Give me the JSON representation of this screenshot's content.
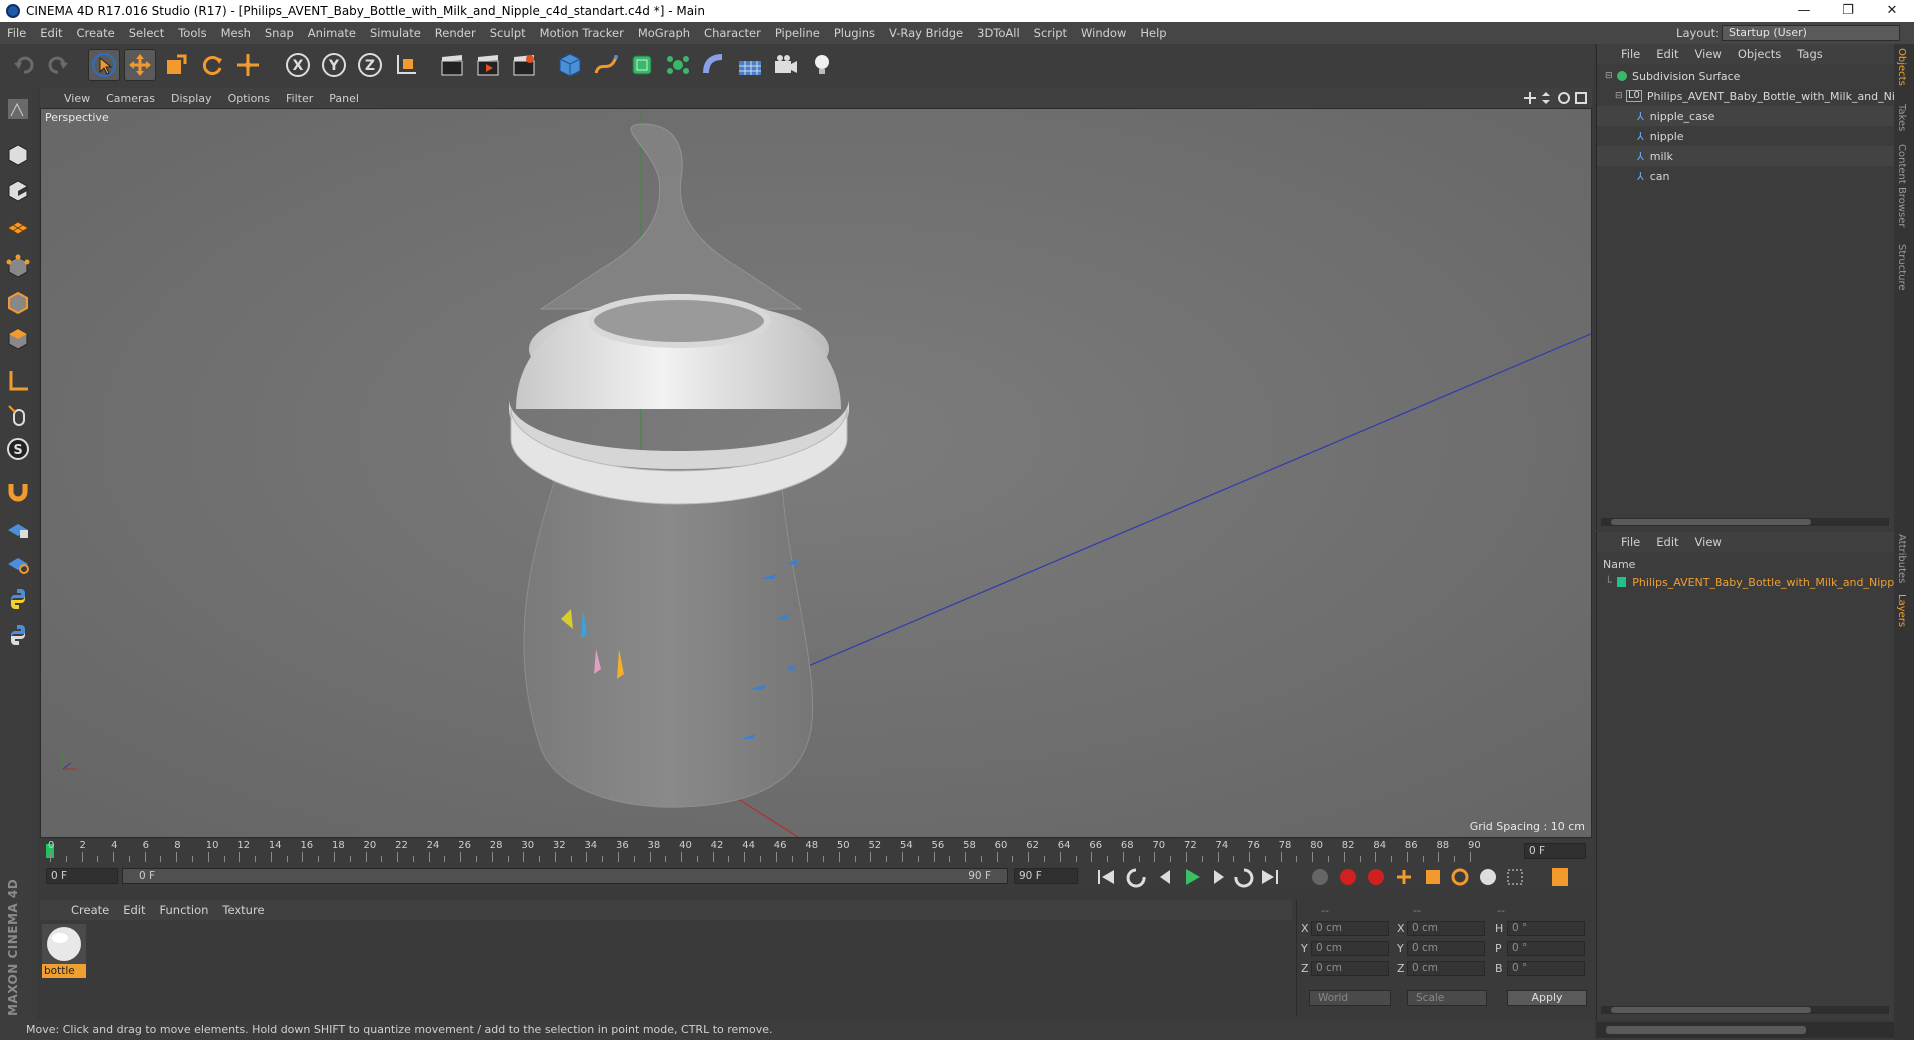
{
  "window": {
    "title": "CINEMA 4D R17.016 Studio (R17) - [Philips_AVENT_Baby_Bottle_with_Milk_and_Nipple_c4d_standart.c4d *] - Main",
    "controls": [
      "—",
      "❐",
      "✕"
    ]
  },
  "menubar": {
    "items": [
      "File",
      "Edit",
      "Create",
      "Select",
      "Tools",
      "Mesh",
      "Snap",
      "Animate",
      "Simulate",
      "Render",
      "Sculpt",
      "Motion Tracker",
      "MoGraph",
      "Character",
      "Pipeline",
      "Plugins",
      "V-Ray Bridge",
      "3DToAll",
      "Script",
      "Window",
      "Help"
    ],
    "layout_label": "Layout:",
    "layout_value": "Startup (User)"
  },
  "viewport": {
    "menu": [
      "View",
      "Cameras",
      "Display",
      "Options",
      "Filter",
      "Panel"
    ],
    "label": "Perspective",
    "grid_spacing": "Grid Spacing : 10 cm"
  },
  "timeline": {
    "ticks": [
      "0",
      "2",
      "4",
      "6",
      "8",
      "10",
      "12",
      "14",
      "16",
      "18",
      "20",
      "22",
      "24",
      "26",
      "28",
      "30",
      "32",
      "34",
      "36",
      "38",
      "40",
      "42",
      "44",
      "46",
      "48",
      "50",
      "52",
      "54",
      "56",
      "58",
      "60",
      "62",
      "64",
      "66",
      "68",
      "70",
      "72",
      "74",
      "76",
      "78",
      "80",
      "82",
      "84",
      "86",
      "88",
      "90"
    ],
    "current_frame": "0 F"
  },
  "transport": {
    "start_field": "0 F",
    "slider_start": "0 F",
    "slider_end": "90 F",
    "end_field": "90 F"
  },
  "material_manager": {
    "menu": [
      "Create",
      "Edit",
      "Function",
      "Texture"
    ],
    "materials": [
      {
        "name": "bottle"
      }
    ]
  },
  "coordinates": {
    "header": [
      "--",
      "--",
      "--"
    ],
    "rows": [
      {
        "a": "X",
        "av": "0 cm",
        "b": "X",
        "bv": "0 cm",
        "c": "H",
        "cv": "0 °"
      },
      {
        "a": "Y",
        "av": "0 cm",
        "b": "Y",
        "bv": "0 cm",
        "c": "P",
        "cv": "0 °"
      },
      {
        "a": "Z",
        "av": "0 cm",
        "b": "Z",
        "bv": "0 cm",
        "c": "B",
        "cv": "0 °"
      }
    ],
    "world": "World",
    "scale": "Scale",
    "apply": "Apply"
  },
  "object_manager": {
    "menu": [
      "File",
      "Edit",
      "View",
      "Objects",
      "Tags"
    ],
    "objects": [
      {
        "name": "Subdivision Surface",
        "level": 0
      },
      {
        "name": "Philips_AVENT_Baby_Bottle_with_Milk_and_Nipple",
        "level": 1
      },
      {
        "name": "nipple_case",
        "level": 2
      },
      {
        "name": "nipple",
        "level": 2
      },
      {
        "name": "milk",
        "level": 2
      },
      {
        "name": "can",
        "level": 2
      }
    ]
  },
  "layer_manager": {
    "menu": [
      "File",
      "Edit",
      "View"
    ],
    "column": "Name",
    "layers": [
      {
        "name": "Philips_AVENT_Baby_Bottle_with_Milk_and_Nipple",
        "color": "#22c08a"
      }
    ]
  },
  "side_tabs": [
    "Objects",
    "Takes",
    "Content Browser",
    "Structure",
    "Attributes",
    "Layers"
  ],
  "status": "Move: Click and drag to move elements. Hold down SHIFT to quantize movement / add to the selection in point mode, CTRL to remove.",
  "brand": "MAXON CINEMA 4D",
  "colors": {
    "accent": "#f0a030",
    "selected_text": "#f0a030",
    "axis_x": "#c03030",
    "axis_y": "#30a030",
    "axis_z": "#3040c0"
  }
}
